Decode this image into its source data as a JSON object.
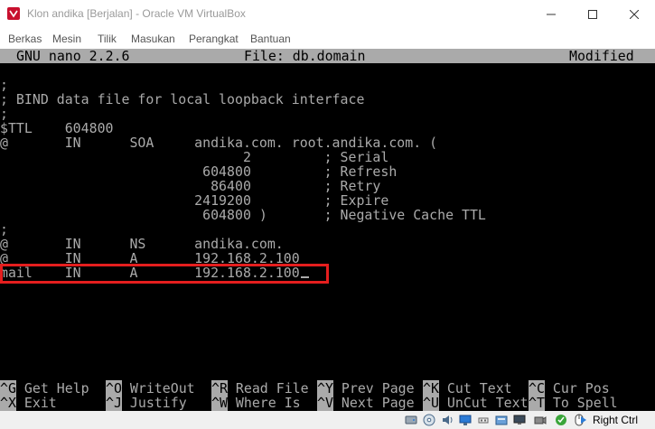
{
  "window": {
    "title": "Klon andika [Berjalan] - Oracle VM VirtualBox"
  },
  "menu": {
    "items": [
      "Berkas",
      "Mesin",
      "Tilik",
      "Masukan",
      "Perangkat",
      "Bantuan"
    ]
  },
  "nano": {
    "version": "GNU nano 2.2.6",
    "file": "File: db.domain",
    "status": "Modified"
  },
  "editor": {
    "lines": [
      ";",
      "; BIND data file for local loopback interface",
      ";",
      "$TTL    604800",
      "@       IN      SOA     andika.com. root.andika.com. (",
      "                              2         ; Serial",
      "                         604800         ; Refresh",
      "                          86400         ; Retry",
      "                        2419200         ; Expire",
      "                         604800 )       ; Negative Cache TTL",
      ";",
      "@       IN      NS      andika.com.",
      "@       IN      A       192.168.2.100",
      "mail    IN      A       192.168.2.100"
    ]
  },
  "shortcuts": [
    {
      "key": "^G",
      "label": "Get Help"
    },
    {
      "key": "^O",
      "label": "WriteOut"
    },
    {
      "key": "^R",
      "label": "Read File"
    },
    {
      "key": "^Y",
      "label": "Prev Page"
    },
    {
      "key": "^K",
      "label": "Cut Text"
    },
    {
      "key": "^C",
      "label": "Cur Pos"
    },
    {
      "key": "^X",
      "label": "Exit"
    },
    {
      "key": "^J",
      "label": "Justify"
    },
    {
      "key": "^W",
      "label": "Where Is"
    },
    {
      "key": "^V",
      "label": "Next Page"
    },
    {
      "key": "^U",
      "label": "UnCut Text"
    },
    {
      "key": "^T",
      "label": "To Spell"
    }
  ],
  "statusbar": {
    "host_key": "Right Ctrl",
    "icons": [
      "hard-disk-icon",
      "optical-drive-icon",
      "audio-icon",
      "network-icon",
      "usb-icon",
      "shared-folders-icon",
      "display-icon",
      "video-capture-icon",
      "cpu-icon",
      "mouse-integration-icon",
      "arrow-icon"
    ]
  },
  "colors": {
    "terminal_bg": "#000000",
    "terminal_fg": "#aaaaaa",
    "highlight": "#e51e1e"
  }
}
